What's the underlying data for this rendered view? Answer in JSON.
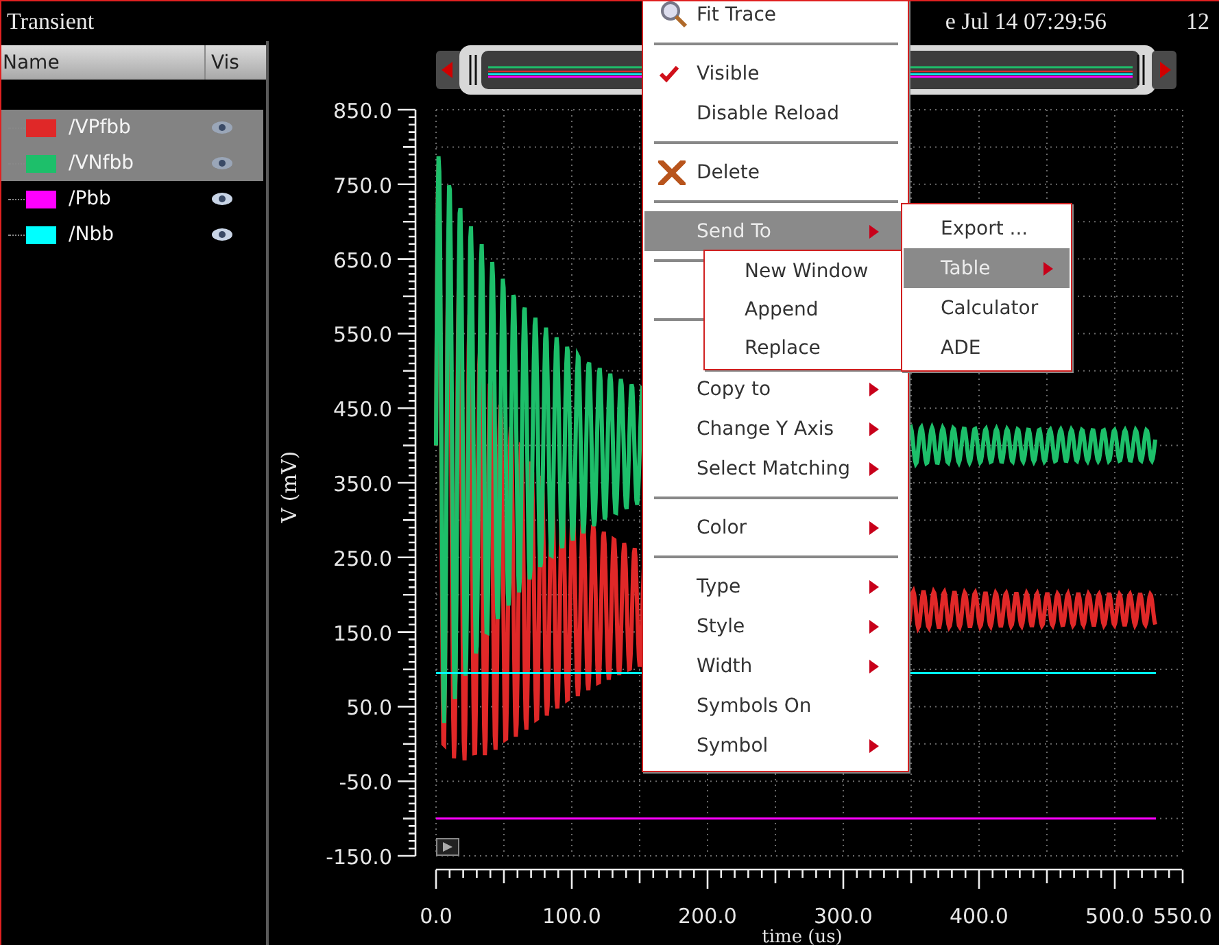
{
  "window": {
    "title": "Transient",
    "date": "e Jul 14 07:29:56",
    "corner_text": "12"
  },
  "trace_list": {
    "columns": [
      "Name",
      "Vis"
    ],
    "traces": [
      {
        "name": "/VPfbb",
        "color": "#e02828",
        "selected": true,
        "visible": true
      },
      {
        "name": "/VNfbb",
        "color": "#1dbf6a",
        "selected": true,
        "visible": true
      },
      {
        "name": "/Pbb",
        "color": "#ff00ff",
        "selected": false,
        "visible": true
      },
      {
        "name": "/Nbb",
        "color": "#00ffff",
        "selected": false,
        "visible": true
      }
    ]
  },
  "plot": {
    "y_axis_label": "V (mV)",
    "x_axis_label": "time (us)",
    "y_tick_labels": [
      "850.0",
      "750.0",
      "650.0",
      "550.0",
      "450.0",
      "350.0",
      "250.0",
      "150.0",
      "50.0",
      "-50.0",
      "-150.0"
    ],
    "x_tick_labels": [
      "0.0",
      "100.0",
      "200.0",
      "300.0",
      "400.0",
      "500.0",
      "550.0"
    ]
  },
  "context_menu": {
    "items": [
      {
        "kind": "fit",
        "label": "Fit Trace",
        "checked": false,
        "submenu": false,
        "selected": false
      },
      {
        "kind": "separator"
      },
      {
        "kind": "item",
        "label": "Visible",
        "checked": true,
        "submenu": false,
        "selected": false
      },
      {
        "kind": "item",
        "label": "Disable Reload",
        "checked": false,
        "submenu": false,
        "selected": false
      },
      {
        "kind": "separator"
      },
      {
        "kind": "delete",
        "label": "Delete",
        "checked": false,
        "submenu": false,
        "selected": false
      },
      {
        "kind": "separator"
      },
      {
        "kind": "item",
        "label": "Send To",
        "checked": false,
        "submenu": true,
        "selected": true
      },
      {
        "kind": "separator"
      },
      {
        "kind": "covered"
      },
      {
        "kind": "separator"
      },
      {
        "kind": "covered"
      },
      {
        "kind": "item",
        "label": "Copy to",
        "checked": false,
        "submenu": true,
        "selected": false
      },
      {
        "kind": "item",
        "label": "Change Y Axis",
        "checked": false,
        "submenu": true,
        "selected": false
      },
      {
        "kind": "item",
        "label": "Select Matching",
        "checked": false,
        "submenu": true,
        "selected": false
      },
      {
        "kind": "separator"
      },
      {
        "kind": "item",
        "label": "Color",
        "checked": false,
        "submenu": true,
        "selected": false
      },
      {
        "kind": "separator"
      },
      {
        "kind": "item",
        "label": "Type",
        "checked": false,
        "submenu": true,
        "selected": false
      },
      {
        "kind": "item",
        "label": "Style",
        "checked": false,
        "submenu": true,
        "selected": false
      },
      {
        "kind": "item",
        "label": "Width",
        "checked": false,
        "submenu": true,
        "selected": false
      },
      {
        "kind": "item",
        "label": "Symbols On",
        "checked": false,
        "submenu": false,
        "selected": false
      },
      {
        "kind": "item",
        "label": "Symbol",
        "checked": false,
        "submenu": true,
        "selected": false
      }
    ]
  },
  "send_to_submenu": {
    "items": [
      {
        "label": "Export ...",
        "submenu": false,
        "selected": false
      },
      {
        "label": "Table",
        "submenu": true,
        "selected": true
      },
      {
        "label": "Calculator",
        "submenu": false,
        "selected": false
      },
      {
        "label": "ADE",
        "submenu": false,
        "selected": false
      }
    ]
  },
  "table_submenu": {
    "items": [
      {
        "label": "New Window",
        "submenu": false,
        "selected": false
      },
      {
        "label": "Append",
        "submenu": false,
        "selected": false
      },
      {
        "label": "Replace",
        "submenu": false,
        "selected": false
      }
    ]
  }
}
